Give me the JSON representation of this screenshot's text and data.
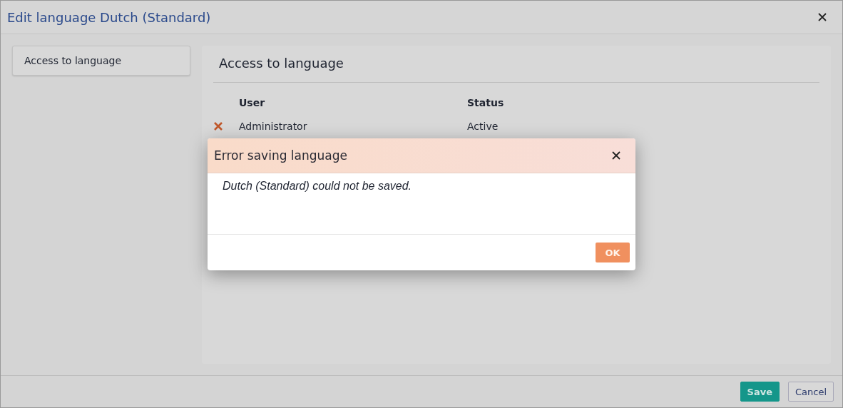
{
  "window": {
    "title": "Edit language Dutch (Standard)"
  },
  "sidebar": {
    "items": [
      {
        "label": "Access to language",
        "selected": true
      }
    ]
  },
  "section": {
    "title": "Access to language"
  },
  "table": {
    "columns": [
      "User",
      "Status"
    ],
    "rows": [
      {
        "user": "Administrator",
        "status": "Active"
      }
    ]
  },
  "footer": {
    "buttons": [
      {
        "label": "Save",
        "kind": "primary"
      },
      {
        "label": "Cancel",
        "kind": "secondary"
      }
    ]
  },
  "dialog": {
    "title": "Error saving language",
    "message": "Dutch (Standard) could not be saved.",
    "buttons": [
      {
        "label": "OK",
        "kind": "primary"
      }
    ]
  }
}
